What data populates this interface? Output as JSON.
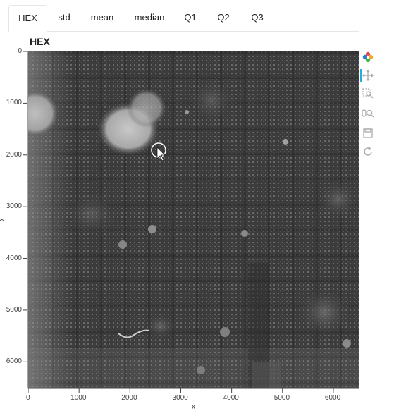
{
  "tabs": [
    {
      "label": "HEX",
      "active": true
    },
    {
      "label": "std",
      "active": false
    },
    {
      "label": "mean",
      "active": false
    },
    {
      "label": "median",
      "active": false
    },
    {
      "label": "Q1",
      "active": false
    },
    {
      "label": "Q2",
      "active": false
    },
    {
      "label": "Q3",
      "active": false
    }
  ],
  "plot": {
    "title": "HEX",
    "ylabel": "y",
    "xlabel": "x",
    "colors": {
      "background": "#3b3b3b",
      "grid_light": "#8a8a8a",
      "blob": "#bdbdbd",
      "toolbar_accent": "#26aae1"
    }
  },
  "chart_data": {
    "type": "image",
    "title": "HEX",
    "xlabel": "x",
    "ylabel": "y",
    "xlim": [
      0,
      6500
    ],
    "ylim": [
      0,
      6500
    ],
    "y_inverted": true,
    "x_ticks": [
      "0",
      "1000",
      "2000",
      "3000",
      "4000",
      "5000",
      "6000"
    ],
    "y_ticks": [
      "0",
      "1000",
      "2000",
      "3000",
      "4000",
      "5000",
      "6000"
    ]
  },
  "toolbar": {
    "tools": [
      {
        "icon": "bokeh-logo-icon"
      },
      {
        "icon": "pan-icon"
      },
      {
        "icon": "box-zoom-icon"
      },
      {
        "icon": "wheel-zoom-icon"
      },
      {
        "icon": "save-icon"
      },
      {
        "icon": "reset-icon"
      }
    ]
  }
}
